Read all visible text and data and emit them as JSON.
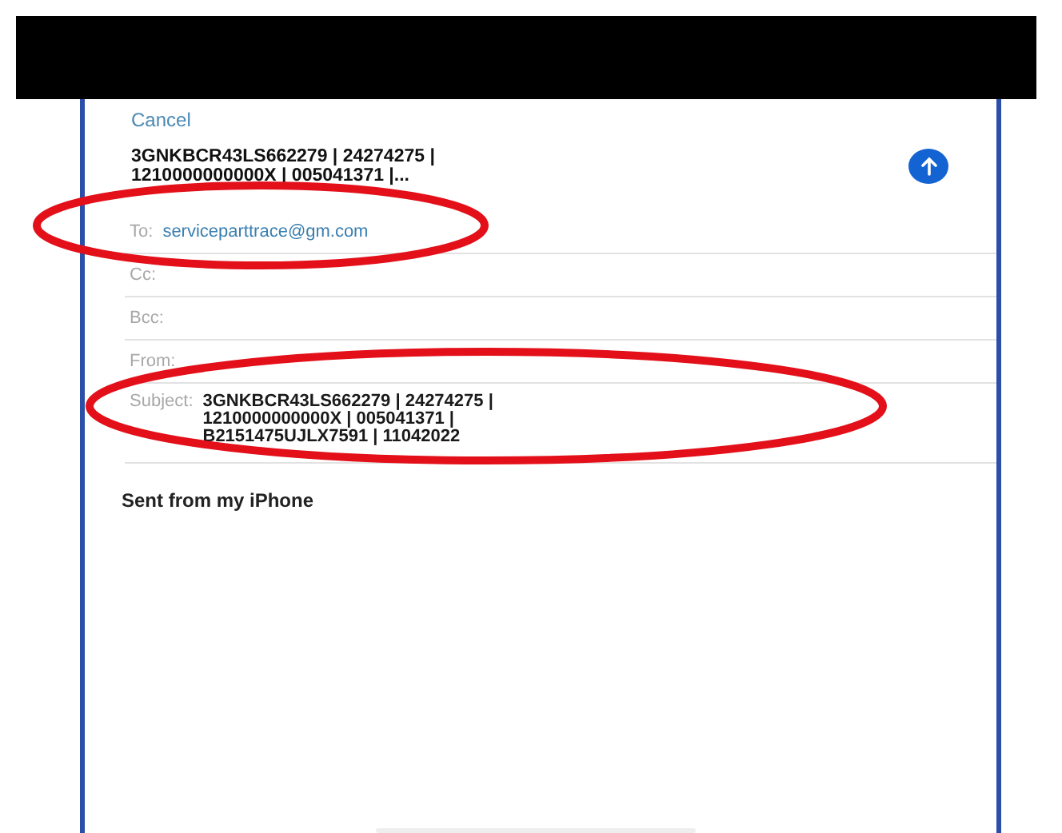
{
  "cancel": "Cancel",
  "title_lines": [
    "3GNKBCR43LS662279 | 24274275 |",
    "1210000000000X | 005041371 |..."
  ],
  "fields": [
    {
      "label": "To:",
      "kind": "recipient",
      "value_lines": [
        "serviceparttrace@gm.com"
      ]
    },
    {
      "label": "Cc:",
      "kind": "empty"
    },
    {
      "label": "Bcc:",
      "kind": "empty"
    },
    {
      "label": "From:",
      "kind": "empty"
    },
    {
      "label": "Subject:",
      "kind": "subject",
      "value_lines": [
        "3GNKBCR43LS662279 | 24274275 |",
        "1210000000000X | 005041371 |",
        "B2151475UJLX7591 | 11042022"
      ]
    }
  ],
  "body": "Sent from my iPhone"
}
